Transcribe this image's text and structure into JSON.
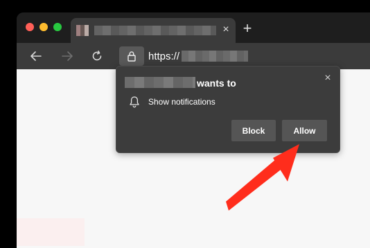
{
  "browser": {
    "url_prefix": "https://",
    "tab_close_glyph": "×",
    "new_tab_glyph": "+"
  },
  "permission_popup": {
    "title_suffix": "wants to",
    "permission": "Show notifications",
    "buttons": {
      "block": "Block",
      "allow": "Allow"
    },
    "close_glyph": "×"
  },
  "annotation": {
    "arrow_color": "#ff2d1c"
  },
  "icons": {
    "back": "back-arrow-icon",
    "forward": "forward-arrow-icon",
    "reload": "reload-icon",
    "lock": "lock-icon",
    "bell": "bell-icon"
  }
}
